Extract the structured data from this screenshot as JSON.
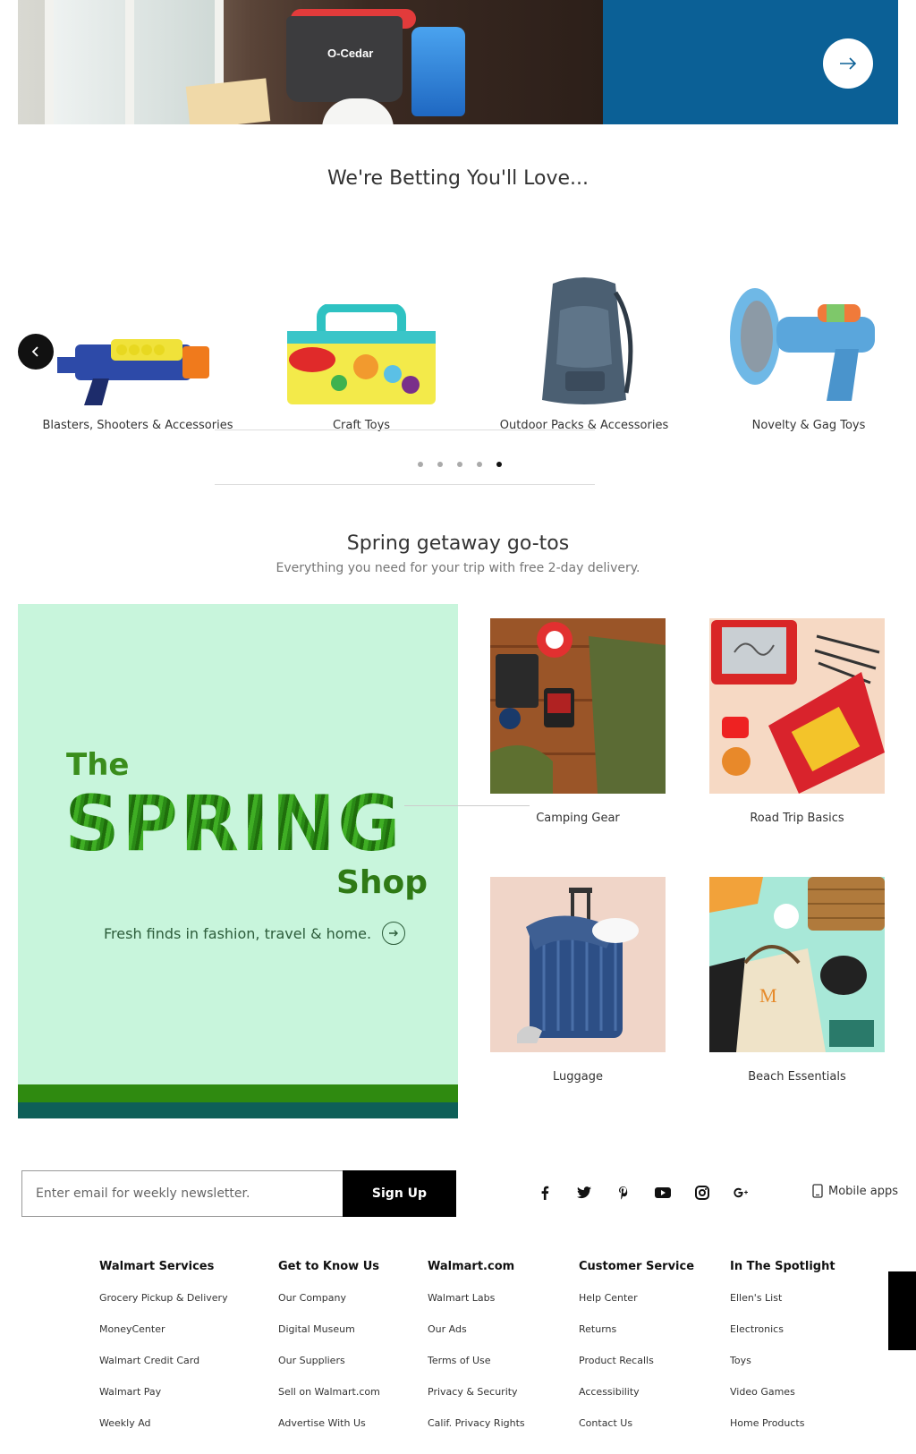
{
  "hero": {
    "brand_text": "O-Cedar",
    "colors": {
      "panel": "#0b6096"
    },
    "arrow_icon": "arrow-right-icon"
  },
  "betting": {
    "title": "We're Betting You'll Love...",
    "items": [
      {
        "label": "Blasters, Shooters & Accessories",
        "image": "toy-blaster"
      },
      {
        "label": "Craft Toys",
        "image": "play-doh-case"
      },
      {
        "label": "Outdoor Packs & Accessories",
        "image": "backpack"
      },
      {
        "label": "Novelty & Gag Toys",
        "image": "gag-blaster"
      }
    ],
    "dots_total": 5,
    "dots_active_index": 4,
    "prev_icon": "chevron-left-icon"
  },
  "spring": {
    "title": "Spring getaway go-tos",
    "subtitle": "Everything you need for your trip with free 2-day delivery.",
    "panel": {
      "line1": "The",
      "line2": "SPRING",
      "line3": "Shop",
      "tagline": "Fresh finds in fashion, travel & home.",
      "colors": {
        "background": "#c8f5dc",
        "green": "#2f8a10",
        "teal": "#0e5f58"
      }
    },
    "tiles": [
      {
        "label": "Camping Gear",
        "image": "camping-gear-flatlay"
      },
      {
        "label": "Road Trip Basics",
        "image": "road-trip-flatlay"
      },
      {
        "label": "Luggage",
        "image": "blue-suitcase"
      },
      {
        "label": "Beach Essentials",
        "image": "beach-flatlay"
      }
    ]
  },
  "newsletter": {
    "placeholder": "Enter email for weekly newsletter.",
    "button": "Sign Up"
  },
  "social": [
    "facebook-icon",
    "twitter-icon",
    "pinterest-icon",
    "youtube-icon",
    "instagram-icon",
    "google-plus-icon"
  ],
  "mobile_apps": "Mobile apps",
  "footer": {
    "columns": [
      {
        "title": "Walmart Services",
        "links": [
          "Grocery Pickup & Delivery",
          "MoneyCenter",
          "Walmart Credit Card",
          "Walmart Pay",
          "Weekly Ad"
        ]
      },
      {
        "title": "Get to Know Us",
        "links": [
          "Our Company",
          "Digital Museum",
          "Our Suppliers",
          "Sell on Walmart.com",
          "Advertise With Us"
        ]
      },
      {
        "title": "Walmart.com",
        "links": [
          "Walmart Labs",
          "Our Ads",
          "Terms of Use",
          "Privacy & Security",
          "Calif. Privacy Rights"
        ]
      },
      {
        "title": "Customer Service",
        "links": [
          "Help Center",
          "Returns",
          "Product Recalls",
          "Accessibility",
          "Contact Us"
        ]
      },
      {
        "title": "In The Spotlight",
        "links": [
          "Ellen's List",
          "Electronics",
          "Toys",
          "Video Games",
          "Home Products"
        ]
      }
    ]
  }
}
